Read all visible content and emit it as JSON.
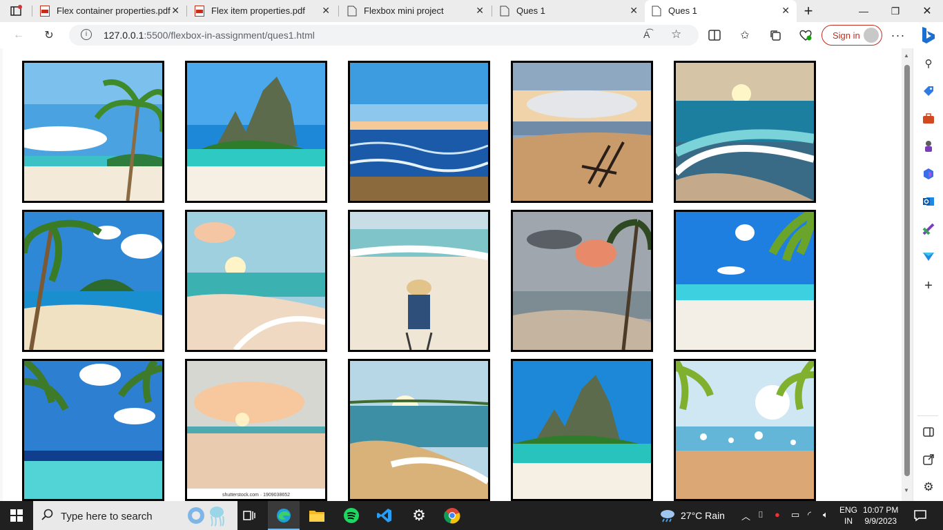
{
  "tabs": [
    {
      "label": "Flex container properties.pdf",
      "icon": "pdf-icon"
    },
    {
      "label": "Flex item properties.pdf",
      "icon": "pdf-icon"
    },
    {
      "label": "Flexbox mini project",
      "icon": "page-icon"
    },
    {
      "label": "Ques 1",
      "icon": "page-icon"
    },
    {
      "label": "Ques 1",
      "icon": "page-icon",
      "active": true
    }
  ],
  "address": {
    "host": "127.0.0.1",
    "path": ":5500/flexbox-in-assignment/ques1.html"
  },
  "toolbar": {
    "sign_in": "Sign in"
  },
  "gallery": {
    "images": [
      "palm-beach",
      "limestone-island",
      "ocean-horizon",
      "beach-chairs",
      "sunset-waves",
      "palm-island",
      "pastel-sunrise",
      "woman-deckchair",
      "stormy-palms",
      "bright-palm-beach",
      "palm-fronds-sky",
      "sandy-sunset",
      "golden-shore",
      "limestone-island-2",
      "palm-sand-bokeh"
    ],
    "caption_12": "shutterstock.com · 1909038652"
  },
  "taskbar": {
    "search_placeholder": "Type here to search",
    "weather": "27°C  Rain",
    "lang_top": "ENG",
    "lang_bottom": "IN",
    "time": "10:07 PM",
    "date": "9/9/2023"
  },
  "colors": {
    "accent": "#c42b1c",
    "taskbar": "#202020",
    "tab_bg": "#ececec"
  }
}
